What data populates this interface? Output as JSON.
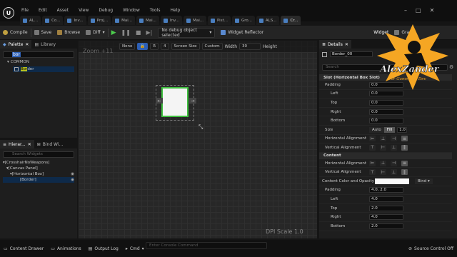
{
  "menu": [
    "File",
    "Edit",
    "Asset",
    "View",
    "Debug",
    "Window",
    "Tools",
    "Help"
  ],
  "doc_tabs": [
    "AL...",
    "Co...",
    "Inv...",
    "Proj...",
    "Mai...",
    "Mai...",
    "Inv...",
    "Mai...",
    "Pist...",
    "Gro...",
    "ALS...",
    "Cr..."
  ],
  "toolbar": {
    "compile": "Compile",
    "save": "Save",
    "browse": "Browse",
    "diff": "Diff",
    "debug_object": "No debug object selected",
    "widget_reflector": "Widget Reflector",
    "designer": "Widget",
    "graph": "Graph"
  },
  "palette": {
    "tab_palette": "Palette",
    "tab_library": "Library",
    "search_value": "bor",
    "category": "COMMON",
    "item": {
      "highlight": "Bor",
      "rest": "der"
    }
  },
  "hierarchy": {
    "tab_hierarchy": "Hierar...",
    "tab_bind": "Bind Wi...",
    "search_placeholder": "Search Widgets",
    "items": [
      "[CrosshairNoWeapons]",
      "[Canvas Panel]",
      "[Horizontal Box]",
      "[Border]"
    ]
  },
  "viewport": {
    "zoom": "Zoom +11",
    "none": "None",
    "r_btn": "R",
    "grid_value": "4",
    "screen_size": "Screen Size",
    "custom": "Custom",
    "width_label": "Width",
    "width_value": "30",
    "height_label": "Height",
    "dpi": "DPI Scale 1.0"
  },
  "details": {
    "tab": "Details",
    "name": "Border_00",
    "search_placeholder": "Search",
    "section_slot": "Slot (Horizontal Box Slot)",
    "padding": "Padding",
    "padding_value": "0.0",
    "left": "Left",
    "left_value": "0.0",
    "top": "Top",
    "top_value": "0.0",
    "right": "Right",
    "right_value": "0.0",
    "bottom": "Bottom",
    "bottom_value": "0.0",
    "size": "Size",
    "size_auto": "Auto",
    "size_fill": "Fill",
    "size_value": "1.0",
    "h_align": "Horizontal Alignment",
    "v_align": "Vertical Alignment",
    "section_content": "Content",
    "c_h_align": "Horizontal Alignment",
    "c_v_align": "Vertical Alignment",
    "content_color": "Content Color and Opacity",
    "bind": "Bind",
    "padding2": "Padding",
    "padding2_value": "4.0, 2.0",
    "left2_value": "4.0",
    "top2_value": "2.0",
    "right2_value": "4.0",
    "bottom2_value": "2.0"
  },
  "status": {
    "content_drawer": "Content Drawer",
    "animations": "Animations",
    "output_log": "Output Log",
    "cmd": "Cmd",
    "console_placeholder": "Enter Console Command",
    "source_control": "Source Control Off"
  },
  "watermark": {
    "name": "AlexZander",
    "tagline": "For Game And Dev"
  },
  "colors": {
    "accent": "#2d5fb5",
    "widget_border": "#3fbf3f",
    "search_highlight": "#b8c020",
    "watermark_orange": "#f5a623"
  }
}
